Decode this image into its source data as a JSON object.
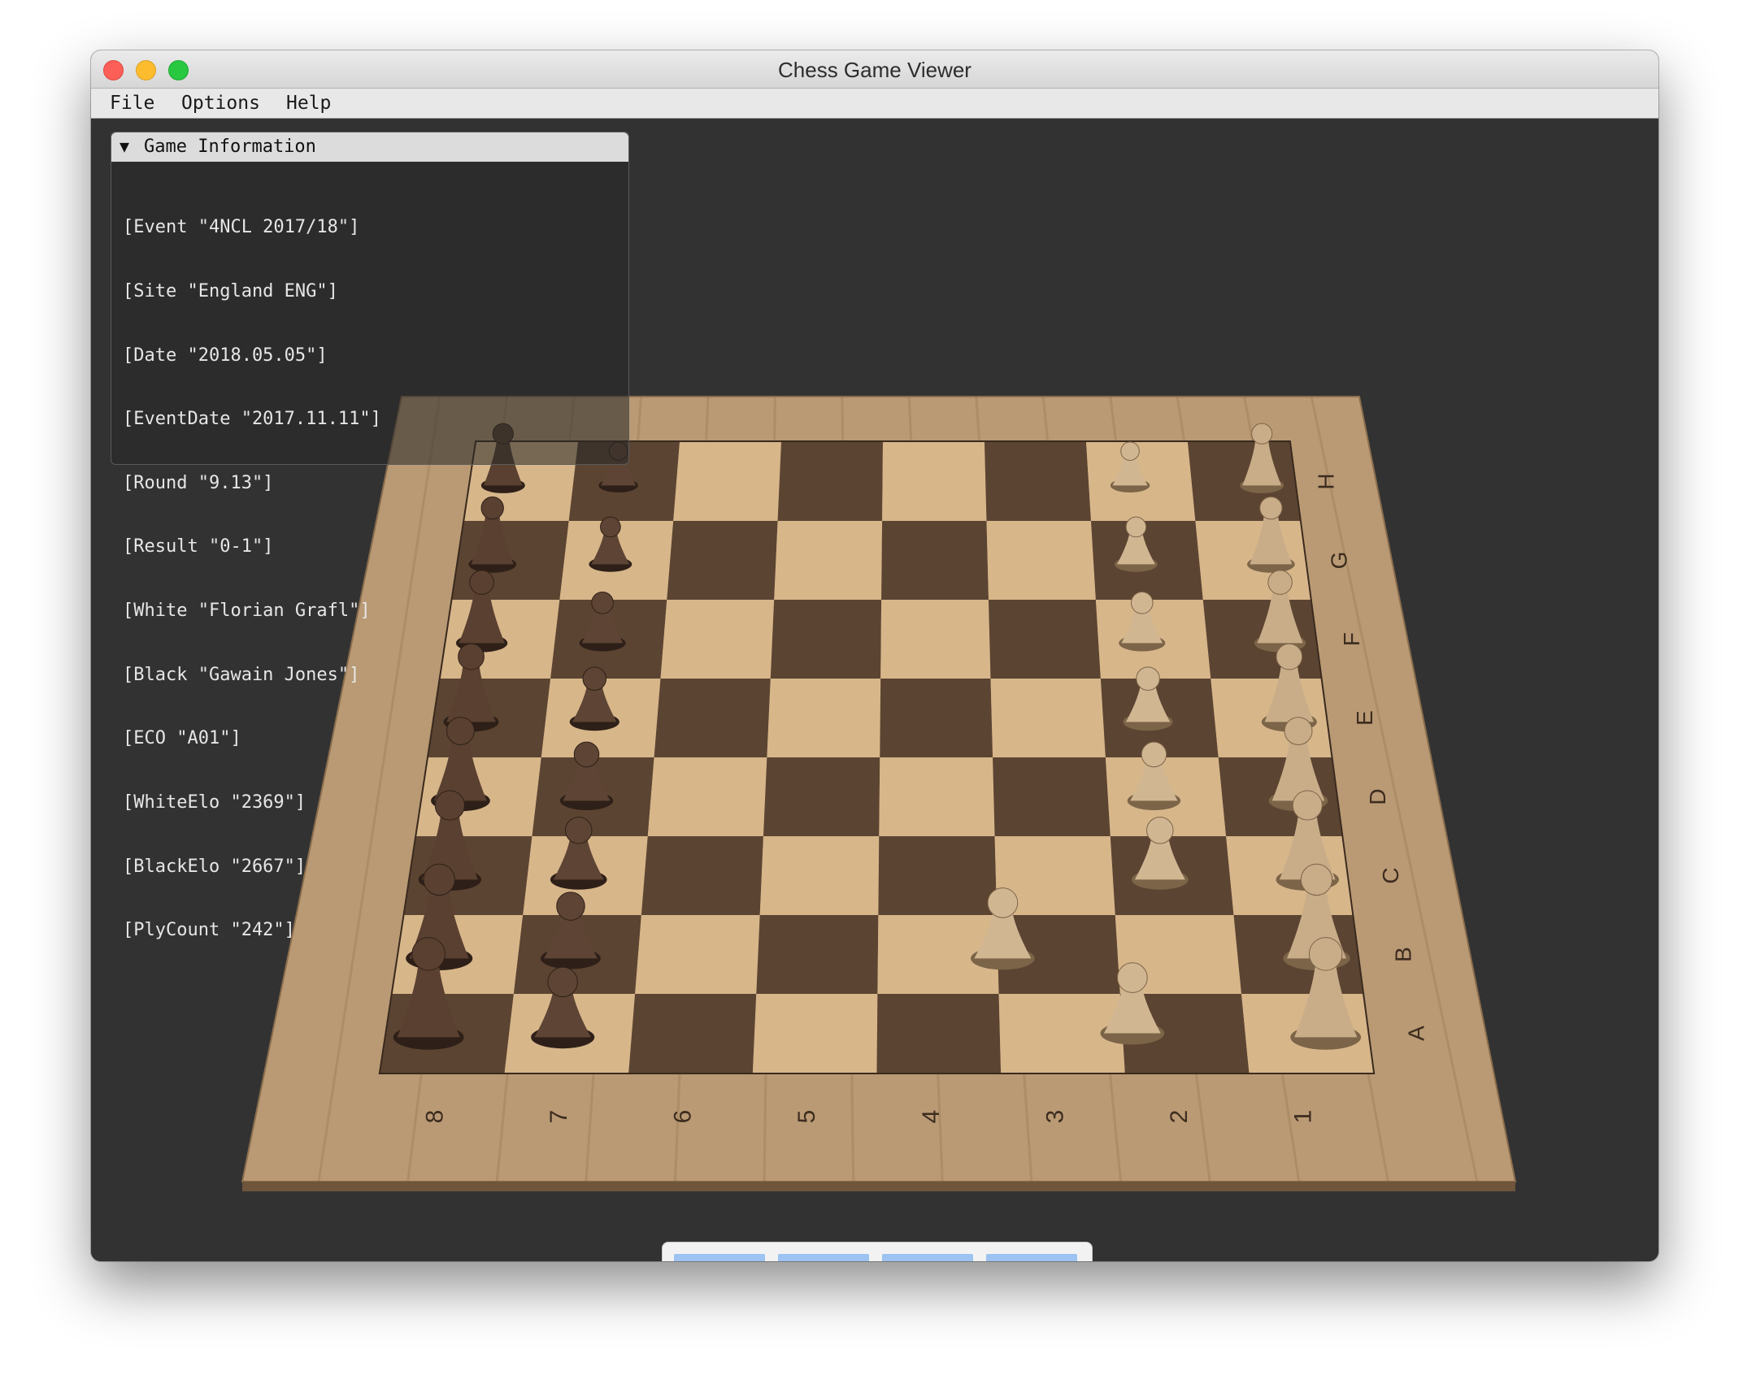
{
  "window": {
    "title": "Chess Game Viewer"
  },
  "menu": [
    "File",
    "Options",
    "Help"
  ],
  "game_info": {
    "header": "Game Information",
    "tags": [
      "[Event \"4NCL 2017/18\"]",
      "[Site \"England ENG\"]",
      "[Date \"2018.05.05\"]",
      "[EventDate \"2017.11.11\"]",
      "[Round \"9.13\"]",
      "[Result \"0-1\"]",
      "[White \"Florian Grafl\"]",
      "[Black \"Gawain Jones\"]",
      "[ECO \"A01\"]",
      "[WhiteElo \"2369\"]",
      "[BlackElo \"2667\"]",
      "[PlyCount \"242\"]"
    ]
  },
  "board": {
    "files": [
      "A",
      "B",
      "C",
      "D",
      "E",
      "F",
      "G",
      "H"
    ],
    "ranks": [
      "1",
      "2",
      "3",
      "4",
      "5",
      "6",
      "7",
      "8"
    ],
    "light_color": "#d7b68a",
    "dark_color": "#5c4432",
    "frame_color": "#b99a74"
  },
  "navigation": {
    "first": "<<",
    "prev": "<",
    "next": ">",
    "last": ">>"
  }
}
